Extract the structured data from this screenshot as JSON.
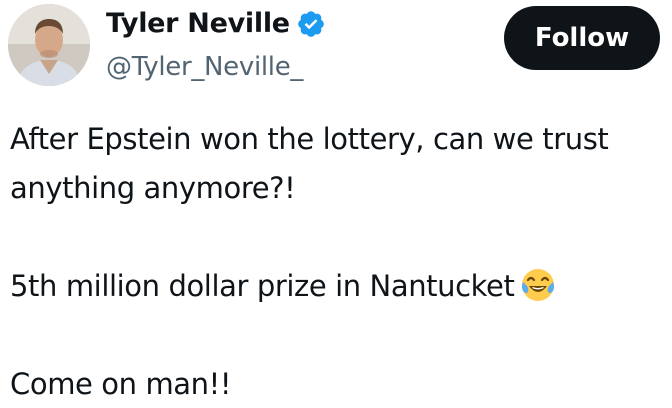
{
  "author": {
    "display_name": "Tyler Neville",
    "handle": "@Tyler_Neville_",
    "verified_icon": "verified-badge-icon",
    "verified_color": "#1d9bf0"
  },
  "follow_button": {
    "label": "Follow",
    "background": "#0f1419"
  },
  "tweet": {
    "lines": [
      "After Epstein won the lottery, can we trust",
      "anything anymore?!",
      "5th million dollar prize in Nantucket",
      "Come on man!!"
    ],
    "emoji": "face-with-tears-of-joy-icon"
  }
}
